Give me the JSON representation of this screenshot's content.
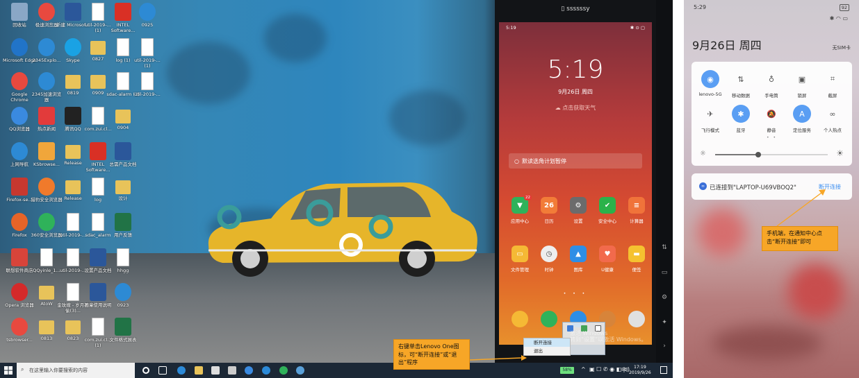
{
  "desktop": {
    "icons": [
      {
        "label": "回收站",
        "kind": "bin"
      },
      {
        "label": "极速浏览器",
        "kind": "chrome"
      },
      {
        "label": "新建 Microsof...",
        "kind": "word"
      },
      {
        "label": "util-2019-... (1)",
        "kind": "file"
      },
      {
        "label": "INTEL Software...",
        "kind": "pdf"
      },
      {
        "label": "0925",
        "kind": "ie"
      },
      {
        "label": "Microsoft Edge",
        "kind": "edge"
      },
      {
        "label": "2345Explo...",
        "kind": "ie2345"
      },
      {
        "label": "Skype",
        "kind": "skype"
      },
      {
        "label": "0827",
        "kind": "folder"
      },
      {
        "label": "log (1)",
        "kind": "file"
      },
      {
        "label": "util-2019-... (1)",
        "kind": "file"
      },
      {
        "label": "Google Chrome",
        "kind": "chrome"
      },
      {
        "label": "2345加速浏览器",
        "kind": "ie2345"
      },
      {
        "label": "0819",
        "kind": "folder"
      },
      {
        "label": "0909",
        "kind": "folder"
      },
      {
        "label": "sdac-alarm (1)",
        "kind": "file"
      },
      {
        "label": "util-2019-...",
        "kind": "file"
      },
      {
        "label": "QQ浏览器",
        "kind": "qqb"
      },
      {
        "label": "热点新闻",
        "kind": "hot"
      },
      {
        "label": "腾讯QQ",
        "kind": "qq"
      },
      {
        "label": "com.zui.cl...",
        "kind": "file"
      },
      {
        "label": "0904",
        "kind": "folder"
      },
      {
        "label": "上网导航",
        "kind": "ie"
      },
      {
        "label": "KSbrowse...",
        "kind": "ks"
      },
      {
        "label": "Release",
        "kind": "folder"
      },
      {
        "label": "INTEL Software...",
        "kind": "pdf"
      },
      {
        "label": "总需产品文档",
        "kind": "word"
      },
      {
        "label": "Firefox-se...",
        "kind": "win"
      },
      {
        "label": "猎豹安全浏览器",
        "kind": "lb"
      },
      {
        "label": "Release",
        "kind": "folder"
      },
      {
        "label": "log",
        "kind": "file"
      },
      {
        "label": "设计",
        "kind": "folder"
      },
      {
        "label": "Firefox",
        "kind": "firefox"
      },
      {
        "label": "360安全浏览器",
        "kind": "e360"
      },
      {
        "label": "util-2019-...",
        "kind": "file"
      },
      {
        "label": "sdac_alarm",
        "kind": "file"
      },
      {
        "label": "用户反馈",
        "kind": "excel"
      },
      {
        "label": "联想软件商店",
        "kind": "store"
      },
      {
        "label": "QQyinle_1...",
        "kind": "file"
      },
      {
        "label": "util-2019-...",
        "kind": "file"
      },
      {
        "label": "设置产品文档",
        "kind": "word"
      },
      {
        "label": "hhgg",
        "kind": "file"
      },
      {
        "label": "Opera 浏览器",
        "kind": "opera"
      },
      {
        "label": "AtoW",
        "kind": "folder"
      },
      {
        "label": "金玫嫂 - 岁月神偷(3)...",
        "kind": "file"
      },
      {
        "label": "画童使用说明",
        "kind": "word"
      },
      {
        "label": "0923",
        "kind": "ie"
      },
      {
        "label": "tsbrowser...",
        "kind": "chrome"
      },
      {
        "label": "0813",
        "kind": "folder"
      },
      {
        "label": "0823",
        "kind": "folder"
      },
      {
        "label": "com.zui.cl... (1)",
        "kind": "file"
      },
      {
        "label": "文件格式展表",
        "kind": "excel"
      }
    ],
    "mirror": {
      "title": "ssssssy",
      "status_time": "5:19",
      "status_icons": "✱ ⊙ ▢",
      "time": "5:19",
      "date": "9月26日 周四",
      "weather": "点击获取天气",
      "search_placeholder": "默读选角计划暂停",
      "apps": [
        {
          "label": "应用中心",
          "color": "#2fb25a",
          "glyph": "▼",
          "badge": "22"
        },
        {
          "label": "日历",
          "color": "#f27c38",
          "glyph": "26"
        },
        {
          "label": "设置",
          "color": "#6b6b6b",
          "glyph": "⚙"
        },
        {
          "label": "安全中心",
          "color": "#2bb24a",
          "glyph": "✔"
        },
        {
          "label": "计算器",
          "color": "#f0733a",
          "glyph": "≡"
        },
        {
          "label": "文件管理",
          "color": "#f5b935",
          "glyph": "▭"
        },
        {
          "label": "时钟",
          "color": "#eeeeee",
          "glyph": "◷"
        },
        {
          "label": "图库",
          "color": "#2e8ee6",
          "glyph": "▲"
        },
        {
          "label": "U健康",
          "color": "#f26a4c",
          "glyph": "♥"
        },
        {
          "label": "便签",
          "color": "#f5c230",
          "glyph": "▬"
        }
      ],
      "dock": [
        {
          "color": "#f5b935"
        },
        {
          "color": "#2fb25a"
        },
        {
          "color": "#2e8ee6"
        },
        {
          "color": "#d7843a"
        },
        {
          "color": "#e0e0e0"
        }
      ]
    },
    "context_menu": {
      "items": [
        "断开连接",
        "退出"
      ]
    },
    "watermark": "激活 Windows\n转到“设置”以激活 Windows。",
    "callout": "右键单击Lenovo One图标，可“断开连接”或“退出”程序",
    "taskbar": {
      "search_placeholder": "在这里输入你要搜索的内容",
      "battery": "58%",
      "time": "17:19",
      "date": "2019/9/26",
      "ime": "中"
    }
  },
  "phone": {
    "status_time": "5:29",
    "battery": "92",
    "signal_icons": "✱ ◠ ▭",
    "date": "9月26日 周四",
    "sim": "无SIM卡",
    "tiles": [
      {
        "label": "lenovo-5G",
        "glyph": "◉",
        "on": true
      },
      {
        "label": "移动数据",
        "glyph": "⇅",
        "on": false
      },
      {
        "label": "手电筒",
        "glyph": "♁",
        "on": false
      },
      {
        "label": "锁屏",
        "glyph": "▣",
        "on": false
      },
      {
        "label": "截屏",
        "glyph": "⌗",
        "on": false
      },
      {
        "label": "飞行模式",
        "glyph": "✈",
        "on": false
      },
      {
        "label": "蓝牙",
        "glyph": "✱",
        "on": true
      },
      {
        "label": "静音",
        "glyph": "🔕",
        "on": false
      },
      {
        "label": "定位服务",
        "glyph": "A",
        "on": true
      },
      {
        "label": "个人热点",
        "glyph": "∞",
        "on": false
      }
    ],
    "brightness": 0.38,
    "connection_text": "已连接到\"LAPTOP-U69VBOQ2\"",
    "disconnect_label": "断开连接",
    "callout": "手机端，在通知中心点击“断开连接”即可"
  },
  "colors": {
    "callout": "#f7a627",
    "accent": "#3b8ef0"
  }
}
